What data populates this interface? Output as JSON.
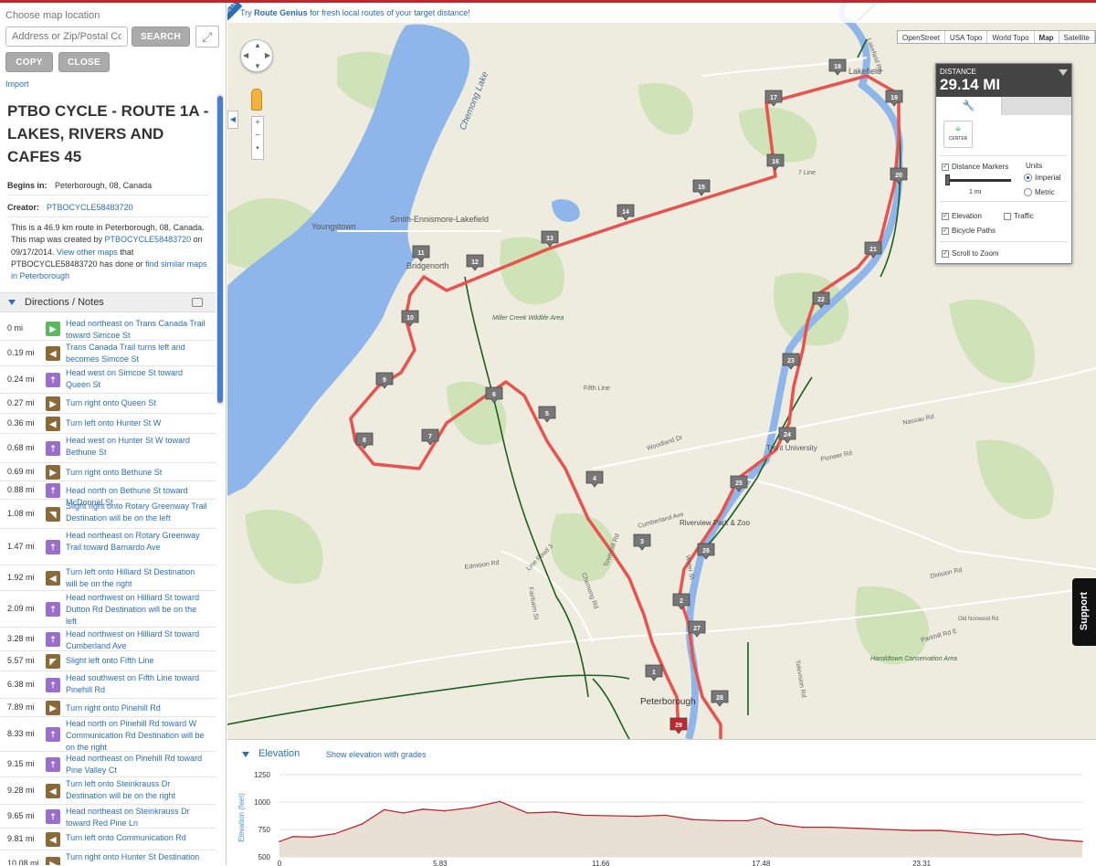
{
  "sidebar": {
    "location_label": "Choose map location",
    "address_placeholder": "Address or Zip/Postal Code",
    "search_label": "SEARCH",
    "copy_label": "COPY",
    "close_label": "CLOSE",
    "import_label": "Import"
  },
  "route": {
    "title": "PTBO CYCLE - ROUTE 1A - LAKES, RIVERS AND CAFES 45",
    "begins_label": "Begins in:",
    "begins_value": "Peterborough, 08, Canada",
    "creator_label": "Creator:",
    "creator_value": "PTBOCYCLE58483720",
    "desc_1": "This is a 46.9 km route in Peterborough, 08, Canada. This map was created by ",
    "desc_creator": "PTBOCYCLE58483720",
    "desc_2": " on 09/17/2014. ",
    "desc_link1": "View other maps",
    "desc_3": " that PTBOCYCLE58483720 has done or ",
    "desc_link2": "find similar maps in Peterborough"
  },
  "directions": {
    "header": "Directions / Notes",
    "items": [
      {
        "dist": "0 mi",
        "icon": "start-icon",
        "text": "Head northeast on Trans Canada Trail toward Simcoe St"
      },
      {
        "dist": "0.19 mi",
        "icon": "turn-left-icon",
        "text": "Trans Canada Trail turns left and becomes Simcoe St"
      },
      {
        "dist": "0.24 mi",
        "icon": "head-icon",
        "text": "Head west on Simcoe St toward Queen St"
      },
      {
        "dist": "0.27 mi",
        "icon": "turn-right-icon",
        "text": "Turn right onto Queen St"
      },
      {
        "dist": "0.36 mi",
        "icon": "turn-left-icon",
        "text": "Turn left onto Hunter St W"
      },
      {
        "dist": "0.68 mi",
        "icon": "head-icon",
        "text": "Head west on Hunter St W toward Bethune St"
      },
      {
        "dist": "0.69 mi",
        "icon": "turn-right-icon",
        "text": "Turn right onto Bethune St"
      },
      {
        "dist": "0.88 mi",
        "icon": "head-icon",
        "text": "Head north on Bethune St toward McDonnel St"
      },
      {
        "dist": "1.08 mi",
        "icon": "slight-right-icon",
        "text": "Slight right onto Rotary Greenway Trail Destination will be on the left"
      },
      {
        "dist": "1.47 mi",
        "icon": "head-icon",
        "text": "Head northeast on Rotary Greenway Trail toward Barnardo Ave"
      },
      {
        "dist": "1.92 mi",
        "icon": "turn-left-icon",
        "text": "Turn left onto Hilliard St Destination will be on the right"
      },
      {
        "dist": "2.09 mi",
        "icon": "head-icon",
        "text": "Head northwest on Hilliard St toward Dutton Rd Destination will be on the left"
      },
      {
        "dist": "3.28 mi",
        "icon": "head-icon",
        "text": "Head northwest on Hilliard St toward Cumberland Ave"
      },
      {
        "dist": "5.57 mi",
        "icon": "slight-left-icon",
        "text": "Slight left onto Fifth Line"
      },
      {
        "dist": "6.38 mi",
        "icon": "head-icon",
        "text": "Head southwest on Fifth Line toward Pinehill Rd"
      },
      {
        "dist": "7.89 mi",
        "icon": "turn-right-icon",
        "text": "Turn right onto Pinehill Rd"
      },
      {
        "dist": "8.33 mi",
        "icon": "head-icon",
        "text": "Head north on Pinehill Rd toward W Communication Rd Destination will be on the right"
      },
      {
        "dist": "9.15 mi",
        "icon": "head-icon",
        "text": "Head northeast on Pinehill Rd toward Pine Valley Ct"
      },
      {
        "dist": "9.28 mi",
        "icon": "turn-left-icon",
        "text": "Turn left onto Steinkrauss Dr Destination will be on the right"
      },
      {
        "dist": "9.65 mi",
        "icon": "head-icon",
        "text": "Head northeast on Steinkrauss Dr toward Red Pine Ln"
      },
      {
        "dist": "9.81 mi",
        "icon": "turn-left-icon",
        "text": "Turn left onto Communication Rd"
      },
      {
        "dist": "10.08 mi",
        "icon": "turn-right-icon",
        "text": "Turn right onto Hunter St Destination will be on the right"
      }
    ]
  },
  "map": {
    "genius_pre": "Try ",
    "genius_bold": "Route Genius",
    "genius_post": " for fresh local routes of your target distance!",
    "beta": "BETA",
    "tabs": [
      "OpenStreet",
      "USA Topo",
      "World Topo",
      "Map",
      "Satellite"
    ],
    "active_tab": "Map",
    "support": "Support",
    "route_color": "#e8534f",
    "labels": [
      "Chemong Lake",
      "Youngstown",
      "Smith-Ennismore-Lakefield",
      "Bridgenorth",
      "Miller Creek Wildlife Area",
      "Lakefield",
      "Trent University",
      "Riverview Park & Zoo",
      "Peterborough",
      "Haroldtown Conservation Area",
      "Woodland Dr",
      "Fifth Line",
      "7 Line",
      "Division Rd",
      "Parkhill Rd E",
      "Cumberland Ave",
      "Chemong Rd",
      "Towerhill Rd",
      "Line Road 3",
      "Fairbairn St",
      "Edmison Rd",
      "Water St",
      "Television Rd",
      "Old Norwood Rd",
      "Nassau Rd",
      "Pioneer Rd",
      "Lakefield Rd"
    ]
  },
  "markers": [
    "1",
    "2",
    "3",
    "4",
    "5",
    "6",
    "7",
    "8",
    "9",
    "10",
    "11",
    "12",
    "13",
    "14",
    "15",
    "16",
    "17",
    "18",
    "19",
    "20",
    "21",
    "22",
    "23",
    "24",
    "25",
    "26",
    "27",
    "28",
    "29"
  ],
  "distance_panel": {
    "label": "DISTANCE",
    "value": "29.14 MI",
    "center_label": "CENTER",
    "distance_markers": "Distance Markers",
    "units": "Units",
    "imperial": "Imperial",
    "metric": "Metric",
    "slider_label": "1 mi",
    "elevation": "Elevation",
    "traffic": "Traffic",
    "bicycle_paths": "Bicycle Paths",
    "scroll_to_zoom": "Scroll to Zoom"
  },
  "elevation": {
    "title": "Elevation",
    "grades_link": "Show elevation with grades",
    "ylabel": "Elevation (feet)",
    "yticks": [
      "1250",
      "1000",
      "750",
      "500"
    ],
    "xticks": [
      "0",
      "5.83",
      "11.66",
      "17.48",
      "23.31"
    ],
    "ylim": [
      500,
      1250
    ],
    "xlim": [
      0,
      29.14
    ]
  },
  "chart_data": {
    "type": "area",
    "title": "Elevation",
    "xlabel": "",
    "ylabel": "Elevation (feet)",
    "ylim": [
      500,
      1250
    ],
    "xlim": [
      0,
      29.14
    ],
    "x": [
      0,
      0.5,
      1.2,
      2.0,
      3.0,
      3.8,
      4.5,
      5.2,
      6.0,
      7.0,
      8.0,
      9.0,
      10.0,
      11.0,
      12.0,
      13.0,
      14.0,
      15.0,
      16.0,
      17.0,
      17.5,
      18.0,
      19.0,
      20.0,
      21.0,
      22.0,
      23.0,
      24.0,
      25.0,
      26.0,
      27.0,
      28.0,
      29.14
    ],
    "series": [
      {
        "values": [
          640,
          685,
          680,
          710,
          800,
          930,
          900,
          935,
          920,
          950,
          1005,
          900,
          910,
          880,
          875,
          870,
          880,
          840,
          830,
          830,
          855,
          800,
          770,
          770,
          760,
          750,
          740,
          740,
          720,
          700,
          710,
          660,
          640
        ]
      }
    ]
  }
}
